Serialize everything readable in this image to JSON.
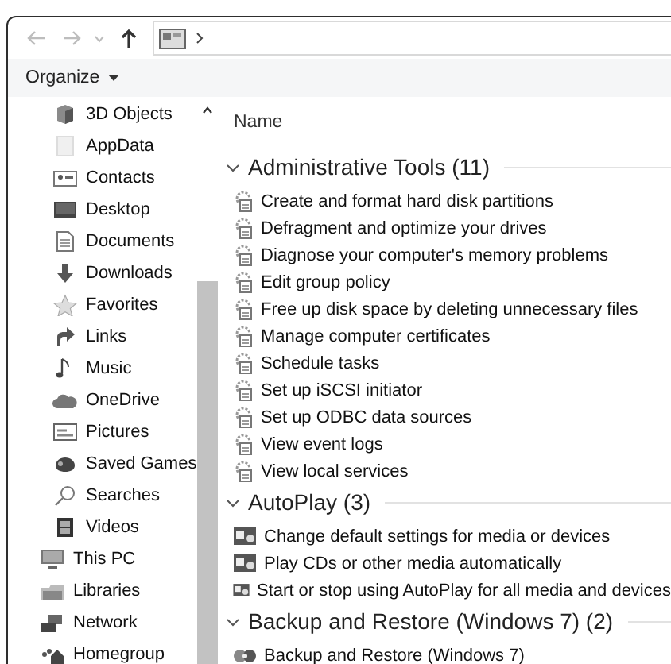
{
  "navigation": [
    {
      "kind": "back",
      "disabled": true
    },
    {
      "kind": "forward",
      "disabled": true
    },
    {
      "kind": "recent",
      "disabled": true
    },
    {
      "kind": "up",
      "disabled": false
    }
  ],
  "toolbar": {
    "organize": "Organize"
  },
  "sidebar": {
    "items": [
      {
        "children": [
          {
            "label": "3D Objects",
            "kind": "cube"
          },
          {
            "label": "AppData",
            "kind": "blank"
          },
          {
            "label": "Contacts",
            "kind": "contacts"
          },
          {
            "label": "Desktop",
            "kind": "desktop"
          },
          {
            "label": "Documents",
            "kind": "documents"
          },
          {
            "label": "Downloads",
            "kind": "downloads"
          },
          {
            "label": "Favorites",
            "kind": "favorites"
          },
          {
            "label": "Links",
            "kind": "links"
          },
          {
            "label": "Music",
            "kind": "music"
          },
          {
            "label": "OneDrive",
            "kind": "cloud"
          },
          {
            "label": "Pictures",
            "kind": "pictures"
          },
          {
            "label": "Saved Games",
            "kind": "games"
          },
          {
            "label": "Searches",
            "kind": "searches"
          },
          {
            "label": "Videos",
            "kind": "videos"
          }
        ]
      },
      {
        "label": "This PC",
        "kind": "pc"
      },
      {
        "label": "Libraries",
        "kind": "libraries"
      },
      {
        "label": "Network",
        "kind": "network"
      },
      {
        "label": "Homegroup",
        "kind": "homegroup"
      }
    ]
  },
  "column_header": "Name",
  "groups": [
    {
      "title": "Administrative Tools (11)",
      "kind": "tools",
      "expanded": true,
      "items": [
        "Create and format hard disk partitions",
        "Defragment and optimize your drives",
        "Diagnose your computer's memory problems",
        "Edit group policy",
        "Free up disk space by deleting unnecessary files",
        "Manage computer certificates",
        "Schedule tasks",
        "Set up iSCSI initiator",
        "Set up ODBC data sources",
        "View event logs",
        "View local services"
      ]
    },
    {
      "title": "AutoPlay (3)",
      "kind": "autoplay",
      "expanded": true,
      "items": [
        "Change default settings for media or devices",
        "Play CDs or other media automatically",
        "Start or stop using AutoPlay for all media and devices"
      ]
    },
    {
      "title": "Backup and Restore (Windows 7) (2)",
      "kind": "backup",
      "expanded": true,
      "items": [
        "Backup and Restore (Windows 7)"
      ]
    }
  ]
}
